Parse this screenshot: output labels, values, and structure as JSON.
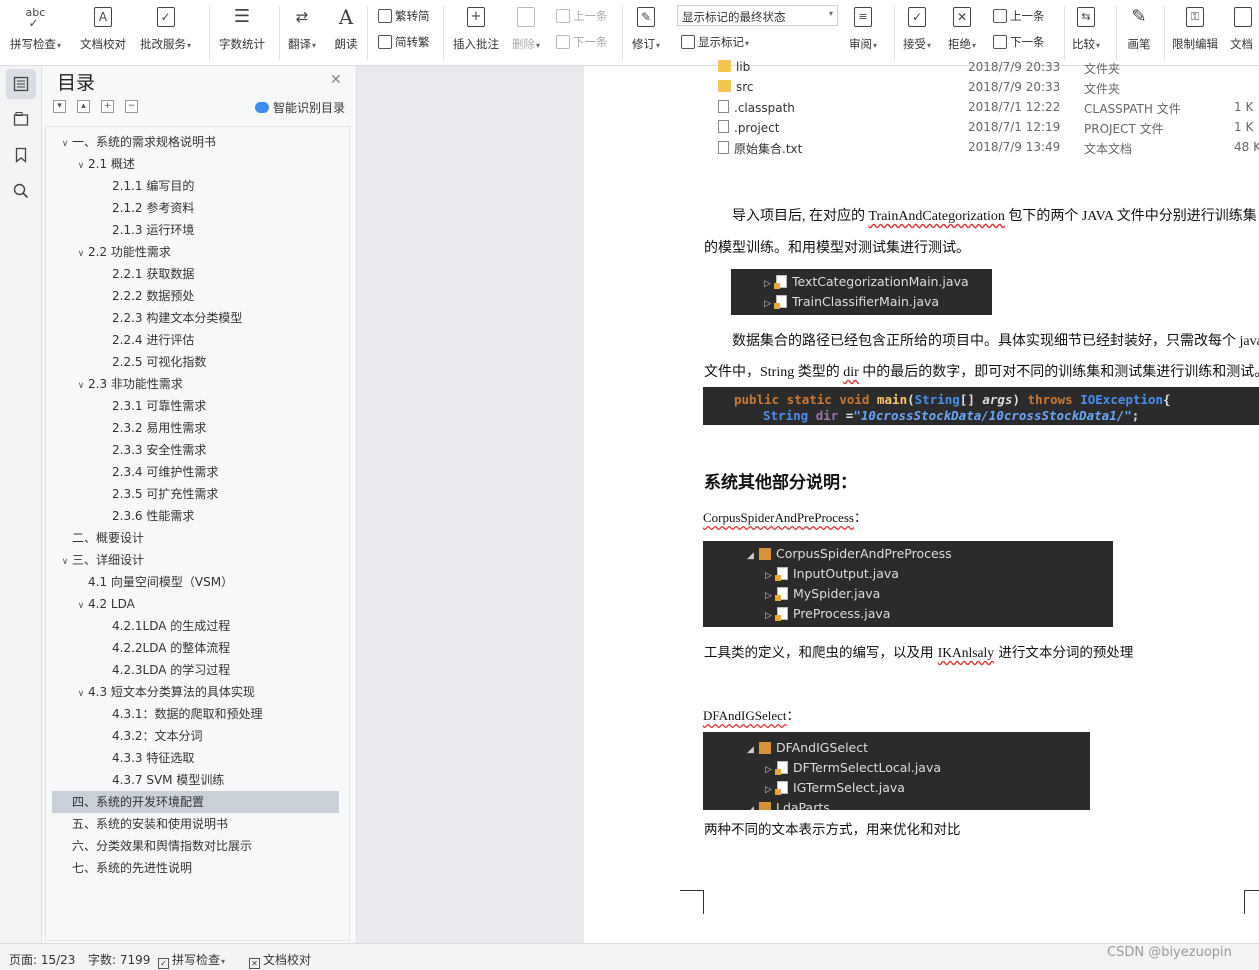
{
  "toolbar": {
    "spellcheck": "拼写检查",
    "doc_check": "文档校对",
    "annotate_service": "批改服务",
    "word_count": "字数统计",
    "translate": "翻译",
    "read_aloud": "朗读",
    "trad_to_simp": "繁转简",
    "simp_to_trad": "简转繁",
    "insert_comment": "插入批注",
    "delete": "删除",
    "prev_comment": "上一条",
    "next_comment": "下一条",
    "revise": "修订",
    "show_marks": "显示标记",
    "markup_state": "显示标记的最终状态",
    "review": "审阅",
    "accept": "接受",
    "reject": "拒绝",
    "prev_change": "上一条",
    "next_change": "下一条",
    "compare": "比较",
    "pen": "画笔",
    "restrict_edit": "限制编辑",
    "doc_more": "文档"
  },
  "rail": {
    "icons": [
      "toc-icon",
      "nav-icon",
      "bookmark-icon",
      "search-icon"
    ]
  },
  "toc": {
    "title": "目录",
    "smart": "智能识别目录",
    "items": [
      {
        "label": "一、系统的需求规格说明书",
        "level": 0,
        "twisty": "v"
      },
      {
        "label": "2.1 概述",
        "level": 1,
        "twisty": "v"
      },
      {
        "label": "2.1.1 编写目的",
        "level": 2,
        "twisty": ""
      },
      {
        "label": "2.1.2 参考资料",
        "level": 2,
        "twisty": ""
      },
      {
        "label": "2.1.3 运行环境",
        "level": 2,
        "twisty": ""
      },
      {
        "label": "2.2   功能性需求",
        "level": 1,
        "twisty": "v"
      },
      {
        "label": "2.2.1 获取数据",
        "level": 2,
        "twisty": ""
      },
      {
        "label": "2.2.2 数据预处",
        "level": 2,
        "twisty": ""
      },
      {
        "label": "2.2.3 构建文本分类模型",
        "level": 2,
        "twisty": ""
      },
      {
        "label": "2.2.4 进行评估",
        "level": 2,
        "twisty": ""
      },
      {
        "label": "2.2.5 可视化指数",
        "level": 2,
        "twisty": ""
      },
      {
        "label": "2.3  非功能性需求",
        "level": 1,
        "twisty": "v"
      },
      {
        "label": "2.3.1 可靠性需求",
        "level": 2,
        "twisty": ""
      },
      {
        "label": "2.3.2 易用性需求",
        "level": 2,
        "twisty": ""
      },
      {
        "label": "2.3.3 安全性需求",
        "level": 2,
        "twisty": ""
      },
      {
        "label": "2.3.4 可维护性需求",
        "level": 2,
        "twisty": ""
      },
      {
        "label": "2.3.5 可扩充性需求",
        "level": 2,
        "twisty": ""
      },
      {
        "label": "2.3.6 性能需求",
        "level": 2,
        "twisty": ""
      },
      {
        "label": "二、概要设计",
        "level": 0,
        "twisty": ""
      },
      {
        "label": "三、详细设计",
        "level": 0,
        "twisty": "v"
      },
      {
        "label": "4.1 向量空间模型（VSM）",
        "level": 1,
        "twisty": ""
      },
      {
        "label": "4.2 LDA",
        "level": 1,
        "twisty": "v"
      },
      {
        "label": "4.2.1LDA 的生成过程",
        "level": 2,
        "twisty": ""
      },
      {
        "label": "4.2.2LDA 的整体流程",
        "level": 2,
        "twisty": ""
      },
      {
        "label": "4.2.3LDA 的学习过程",
        "level": 2,
        "twisty": ""
      },
      {
        "label": "4.3 短文本分类算法的具体实现",
        "level": 1,
        "twisty": "v"
      },
      {
        "label": "4.3.1：数据的爬取和预处理",
        "level": 2,
        "twisty": ""
      },
      {
        "label": "4.3.2：文本分词",
        "level": 2,
        "twisty": ""
      },
      {
        "label": "4.3.3  特征选取",
        "level": 2,
        "twisty": ""
      },
      {
        "label": "4.3.7 SVM 模型训练",
        "level": 2,
        "twisty": ""
      },
      {
        "label": "四、系统的开发环境配置",
        "level": 0,
        "twisty": "",
        "selected": true
      },
      {
        "label": "五、系统的安装和使用说明书",
        "level": 0,
        "twisty": ""
      },
      {
        "label": "六、分类效果和舆情指数对比展示",
        "level": 0,
        "twisty": ""
      },
      {
        "label": "七、系统的先进性说明",
        "level": 0,
        "twisty": ""
      }
    ]
  },
  "doc": {
    "files": [
      {
        "name": "lib",
        "date": "2018/7/9 20:33",
        "type": "文件夹",
        "size": "",
        "kind": "folder"
      },
      {
        "name": "src",
        "date": "2018/7/9 20:33",
        "type": "文件夹",
        "size": "",
        "kind": "folder"
      },
      {
        "name": ".classpath",
        "date": "2018/7/1 12:22",
        "type": "CLASSPATH 文件",
        "size": "1 K",
        "kind": "file"
      },
      {
        "name": ".project",
        "date": "2018/7/1 12:19",
        "type": "PROJECT 文件",
        "size": "1 K",
        "kind": "file"
      },
      {
        "name": "原始集合.txt",
        "date": "2018/7/9 13:49",
        "type": "文本文档",
        "size": "48 K",
        "kind": "file"
      }
    ],
    "p1_a": "导入项目后, 在对应的 ",
    "p1_pkg": "TrainAndCategorization",
    "p1_b": " 包下的两个 JAVA 文件中分别进行训练集",
    "p1_c": "的模型训练。和用模型对测试集进行测试。",
    "tree1": [
      "TextCategorizationMain.java",
      "TrainClassifierMain.java"
    ],
    "p2_a": "数据集合的路径已经包含正所给的项目中。具体实现细节已经封装好，只需改每个 java",
    "p2_b": "文件中，String 类型的 ",
    "p2_dir": "dir",
    "p2_c": " 中的最后的数字，即可对不同的训练集和测试集进行训练和测试。",
    "code_line1": {
      "kw1": "public static void ",
      "fn": "main",
      "p1": "(",
      "t1": "String",
      "p2": "[] ",
      "arg": "args",
      "p3": ") ",
      "kw2": "throws ",
      "ex": "IOException",
      "p4": "{"
    },
    "code_line2": {
      "t": "String ",
      "v": "dir ",
      "eq": "=",
      "s": "\"10crossStockData/10crossStockData1/\"",
      "end": ";"
    },
    "heading": "系统其他部分说明：",
    "sec1_label": "CorpusSpiderAndPreProcess",
    "sec1_colon": "：",
    "tree2_pkg": "CorpusSpiderAndPreProcess",
    "tree2": [
      "InputOutput.java",
      "MySpider.java",
      "PreProcess.java"
    ],
    "p3_a": "工具类的定义，和爬虫的编写，以及用 ",
    "p3_ik": "IKAnlsaly",
    "p3_b": " 进行文本分词的预处理",
    "sec2_label": "DFAndIGSelect",
    "sec2_colon": "：",
    "tree3_pkg": "DFAndIGSelect",
    "tree3": [
      "DFTermSelectLocal.java",
      "IGTermSelect.java"
    ],
    "tree3_cut": "LdaParts",
    "p4": "两种不同的文本表示方式，用来优化和对比"
  },
  "status": {
    "page": "页面: 15/23",
    "words": "字数: 7199",
    "spellcheck": "拼写检查",
    "doccheck": "文档校对"
  },
  "watermark": "CSDN @biyezuopin",
  "colors": {
    "selected_toc": "#c9d0d8",
    "code_bg": "#2b2b2b",
    "keyword": "#cc7832",
    "type": "#4a8ff0",
    "string": "#6aa8ff"
  }
}
